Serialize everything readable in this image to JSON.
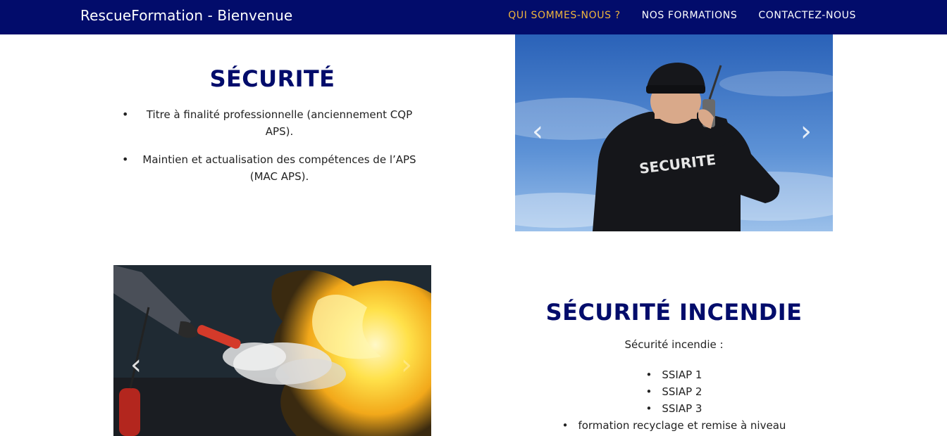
{
  "header": {
    "brand": "RescueFormation - Bienvenue",
    "nav": [
      {
        "label": "QUI SOMMES-NOUS ?",
        "active": true
      },
      {
        "label": "NOS FORMATIONS",
        "active": false
      },
      {
        "label": "CONTACTEZ-NOUS",
        "active": false
      }
    ]
  },
  "section_securite": {
    "title": "SÉCURITÉ",
    "items": [
      "Titre à finalité professionnelle (anciennement CQP APS).",
      "Maintien et actualisation des compétences de l’APS (MAC APS)."
    ],
    "image_label": "SECURITE"
  },
  "section_incendie": {
    "title": "SÉCURITÉ INCENDIE",
    "subtitle": "Sécurité incendie :",
    "items": [
      "SSIAP 1",
      "SSIAP 2",
      "SSIAP 3",
      "formation recyclage et remise à niveau"
    ]
  },
  "carousel": {
    "prev_glyph": "‹",
    "next_glyph": "›"
  },
  "colors": {
    "navy": "#020c6b",
    "accent": "#f0b53d"
  }
}
